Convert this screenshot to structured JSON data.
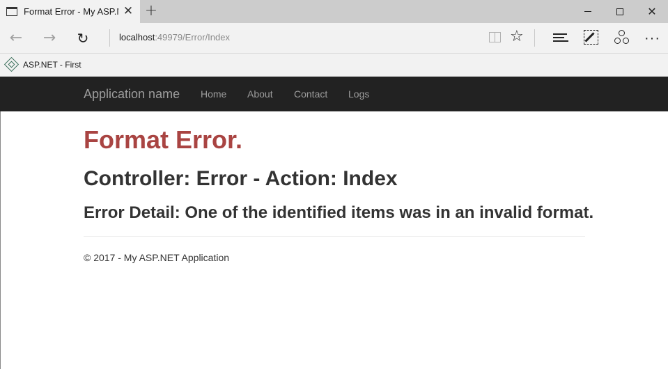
{
  "browser": {
    "tab_title": "Format Error - My ASP.N",
    "tab_close_glyph": "✕",
    "new_tab_glyph": "+",
    "close_glyph": "✕",
    "address_host": "localhost",
    "address_rest": ":49979/Error/Index",
    "back_glyph": "←",
    "forward_glyph": "→",
    "refresh_glyph": "↻",
    "star_glyph": "☆",
    "more_glyph": "···",
    "favorites": [
      {
        "label": "ASP.NET - First"
      }
    ]
  },
  "site": {
    "brand": "Application name",
    "nav": [
      "Home",
      "About",
      "Contact",
      "Logs"
    ],
    "nav_bg": "#222222",
    "nav_text_color": "#9d9d9d"
  },
  "content": {
    "title": "Format Error.",
    "title_color": "#a94442",
    "controller_line": "Controller: Error - Action: Index",
    "detail": "Error Detail: One of the identified items was in an invalid format.",
    "footer": "© 2017 - My ASP.NET Application"
  }
}
